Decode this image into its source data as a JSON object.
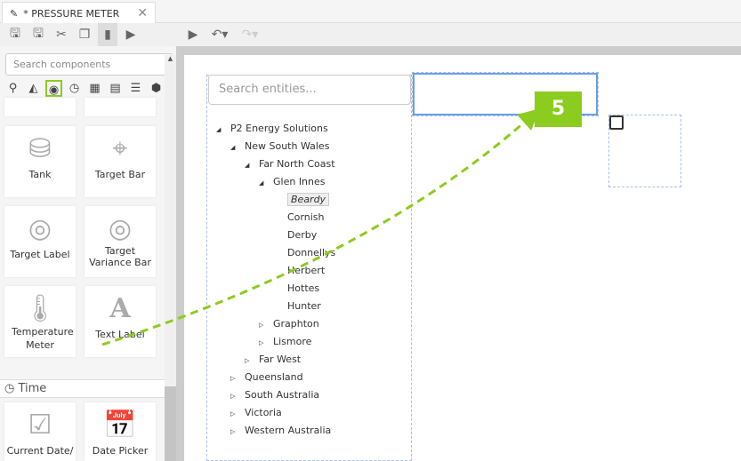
{
  "tab": {
    "title": "* PRESSURE METER",
    "close": "✕"
  },
  "toolbar": {
    "icons": [
      "save-icon",
      "save-as-icon",
      "cut-icon",
      "copy-icon",
      "paste-icon",
      "preview-icon",
      "run-icon",
      "undo-icon",
      "redo-icon"
    ]
  },
  "components": {
    "search_placeholder": "Search components",
    "categories": [
      "hierarchy",
      "charts",
      "indicators",
      "time",
      "layout",
      "table",
      "controls",
      "3d"
    ],
    "cards": [
      {
        "label": "Tank",
        "icon": "tank-icon"
      },
      {
        "label": "Target Bar",
        "icon": "target-bar-icon"
      },
      {
        "label": "Target Label",
        "icon": "target-label-icon"
      },
      {
        "label": "Target Variance Bar",
        "icon": "target-variance-icon"
      },
      {
        "label": "Temperature Meter",
        "icon": "thermometer-icon"
      },
      {
        "label": "Text Label",
        "icon": "text-icon"
      }
    ],
    "section": "Time",
    "time_cards": [
      {
        "label": "Current Date/",
        "icon": "checkbox-icon"
      },
      {
        "label": "Date Picker",
        "icon": "calendar-icon"
      }
    ]
  },
  "tree": {
    "search_placeholder": "Search entities...",
    "nodes": [
      {
        "label": "P2 Energy Solutions",
        "level": 0,
        "state": "open"
      },
      {
        "label": "New South Wales",
        "level": 1,
        "state": "open"
      },
      {
        "label": "Far North Coast",
        "level": 2,
        "state": "open"
      },
      {
        "label": "Glen Innes",
        "level": 3,
        "state": "open"
      },
      {
        "label": "Beardy",
        "level": 4,
        "state": "leaf",
        "selected": true
      },
      {
        "label": "Cornish",
        "level": 4,
        "state": "leaf"
      },
      {
        "label": "Derby",
        "level": 4,
        "state": "leaf"
      },
      {
        "label": "Donnellys",
        "level": 4,
        "state": "leaf"
      },
      {
        "label": "Herbert",
        "level": 4,
        "state": "leaf"
      },
      {
        "label": "Hottes",
        "level": 4,
        "state": "leaf"
      },
      {
        "label": "Hunter",
        "level": 4,
        "state": "leaf"
      },
      {
        "label": "Graphton",
        "level": 3,
        "state": "closed"
      },
      {
        "label": "Lismore",
        "level": 3,
        "state": "closed"
      },
      {
        "label": "Far West",
        "level": 2,
        "state": "closed"
      },
      {
        "label": "Queensland",
        "level": 1,
        "state": "closed"
      },
      {
        "label": "South Australia",
        "level": 1,
        "state": "closed"
      },
      {
        "label": "Victoria",
        "level": 1,
        "state": "closed"
      },
      {
        "label": "Western Australia",
        "level": 1,
        "state": "closed"
      }
    ]
  },
  "step_badge": "5",
  "accent": "#8ccc1e"
}
